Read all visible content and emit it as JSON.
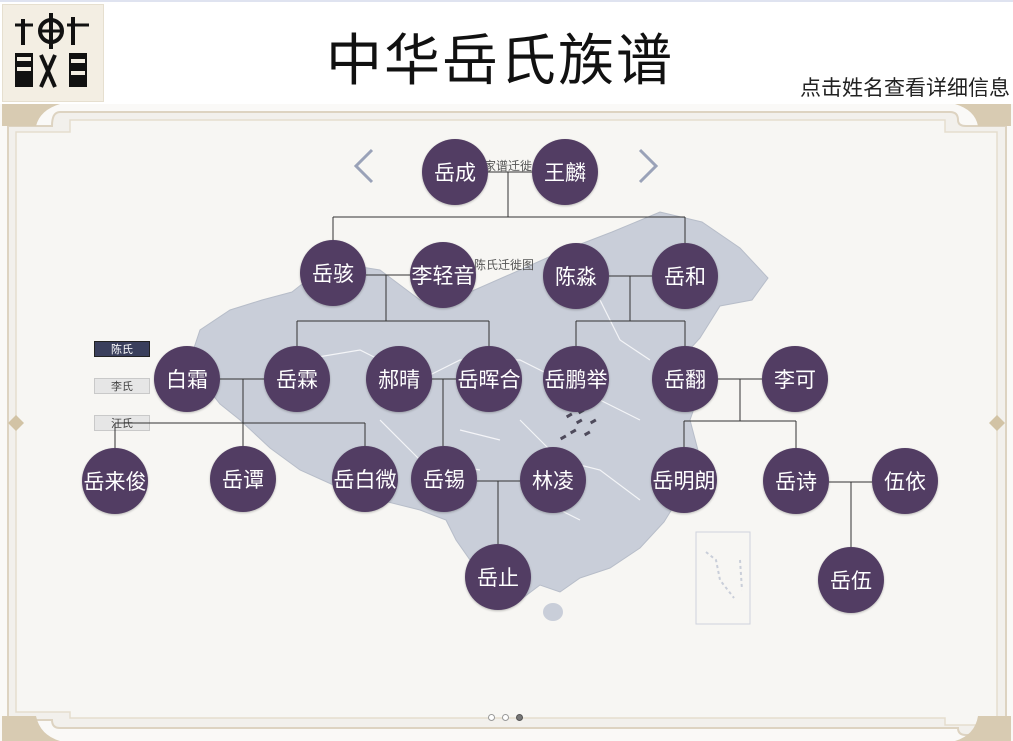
{
  "header": {
    "title": "中华岳氏族谱",
    "hint": "点击姓名查看详细信息",
    "logo": "clan-emblem"
  },
  "map": {
    "caption_top": "家谱迁徙",
    "caption_mid": "陈氏迁徙图"
  },
  "legend": {
    "items": [
      {
        "label": "陈氏",
        "active": true
      },
      {
        "label": "李氏",
        "active": false
      },
      {
        "label": "汪氏",
        "active": false
      }
    ]
  },
  "nav": {
    "prev_icon": "chevron-left-icon",
    "next_icon": "chevron-right-icon"
  },
  "tree": {
    "people": {
      "yuecheng": "岳成",
      "wanglin": "王麟",
      "yuehai": "岳骇",
      "liqingyin": "李轻音",
      "chenmiao": "陈淼",
      "yuehe": "岳和",
      "baishuang": "白霜",
      "yuelin": "岳霖",
      "haoqing": "郝晴",
      "yuehuihe": "岳晖合",
      "yuepengju": "岳鹏举",
      "yuefan": "岳翻",
      "like": "李可",
      "yuelaijun": "岳来俊",
      "yuetan": "岳谭",
      "yuebaiwei": "岳白微",
      "yuexi": "岳锡",
      "linling": "林凌",
      "yuemingnlang": "岳明朗",
      "yueshi": "岳诗",
      "wuyi": "伍依",
      "yuezhi": "岳止",
      "yuewu": "岳伍"
    }
  },
  "pager": {
    "count": 3,
    "current": 3
  },
  "colors": {
    "node": "#523d63",
    "frame": "#d9cbb1",
    "map": "#c8cdd8"
  }
}
